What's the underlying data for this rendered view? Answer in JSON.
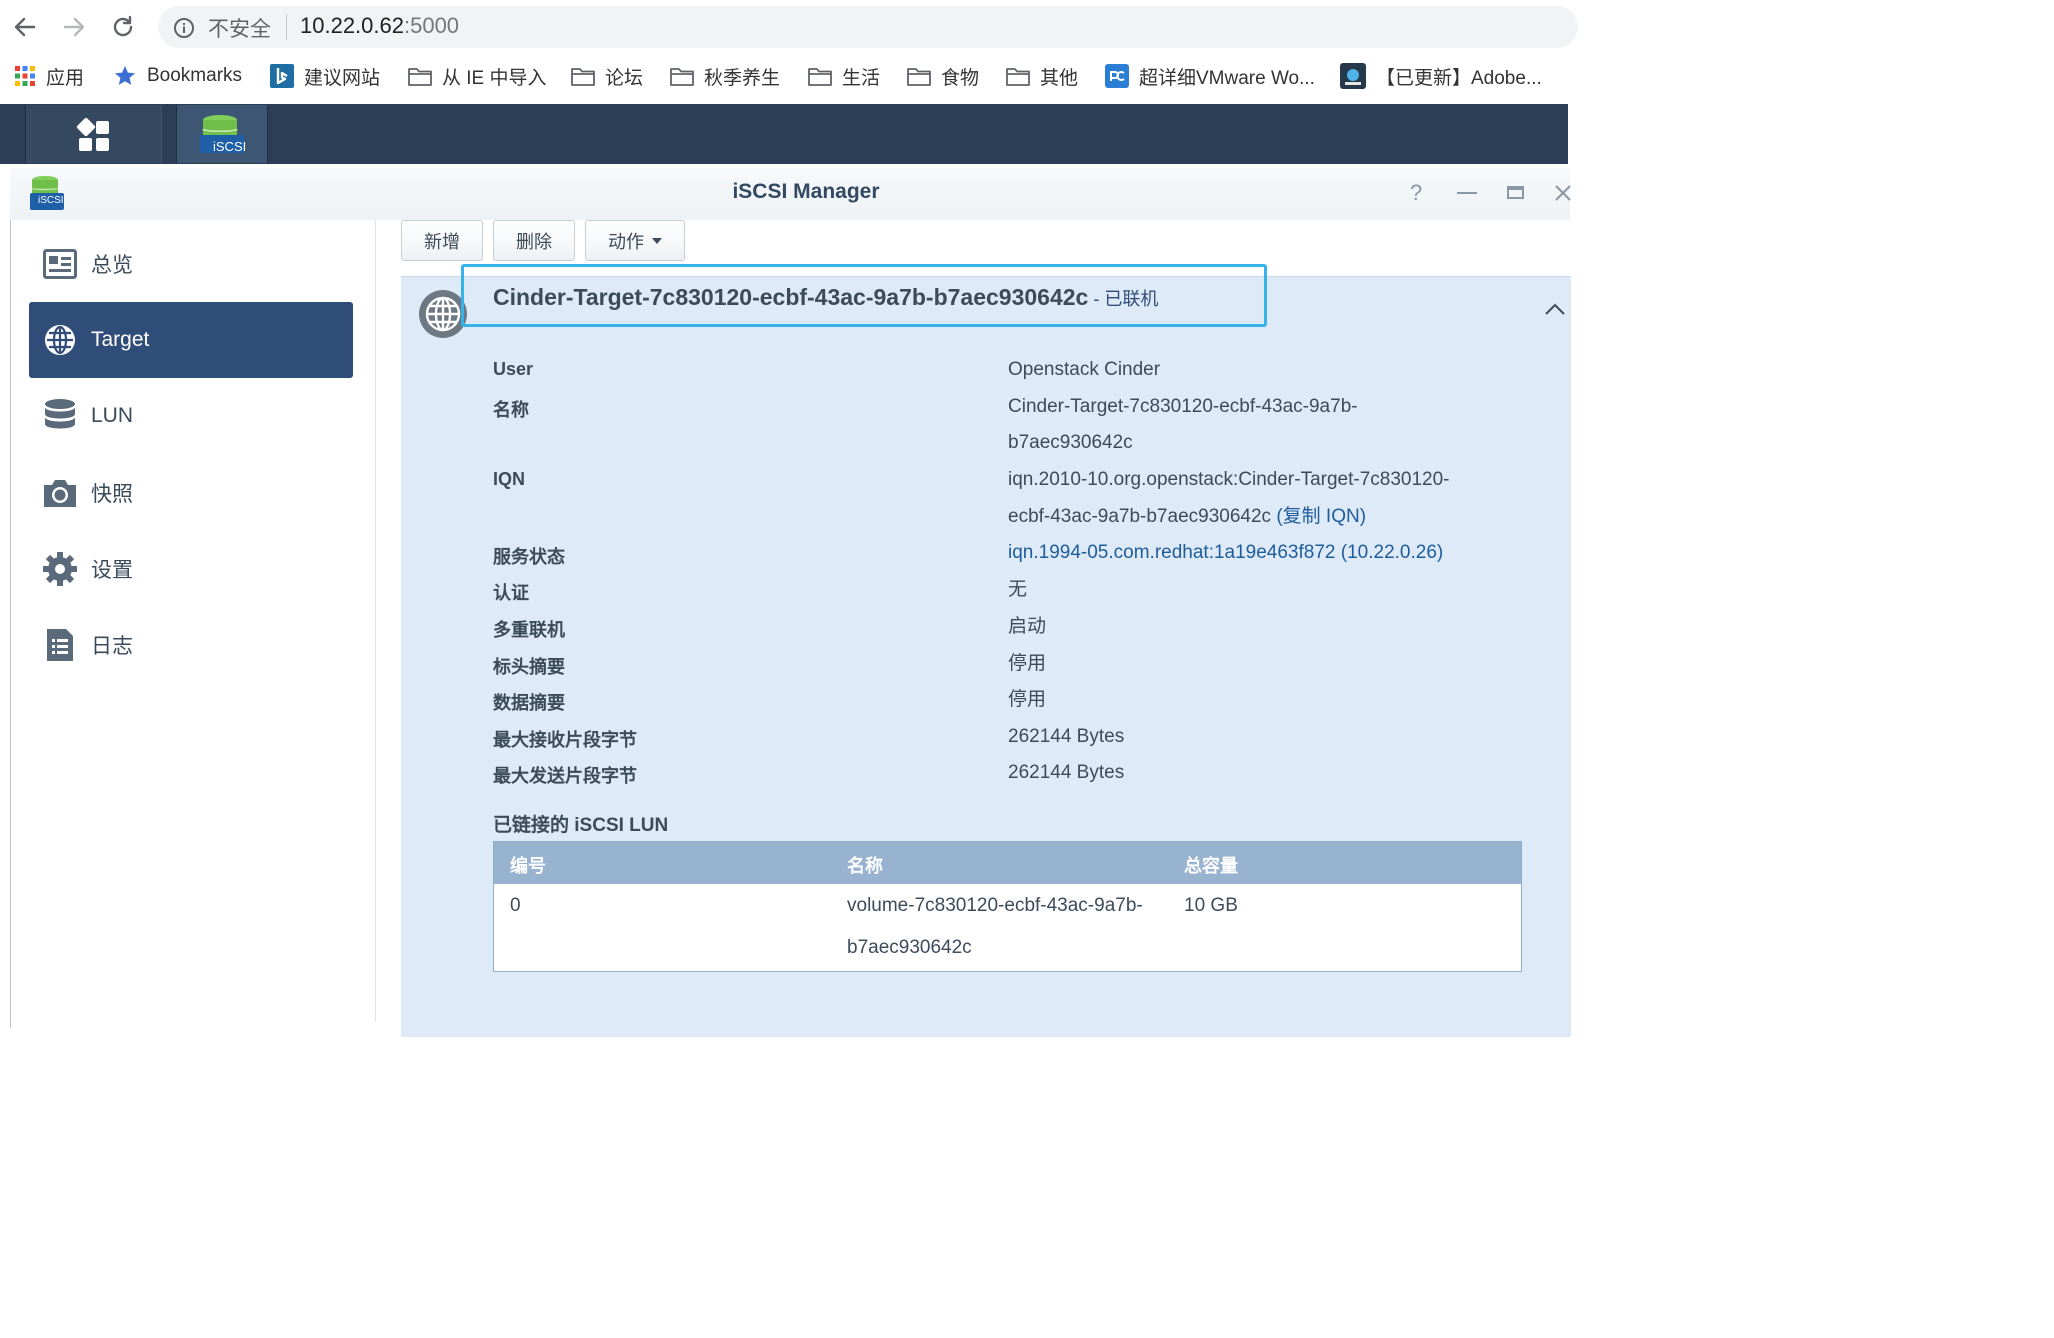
{
  "browser": {
    "security_label": "不安全",
    "url_host": "10.22.0.62",
    "url_port": ":5000",
    "bookmarks": [
      {
        "label": "应用",
        "icon": "apps-grid-icon"
      },
      {
        "label": "Bookmarks",
        "icon": "star-icon"
      },
      {
        "label": "建议网站",
        "icon": "bing-icon"
      },
      {
        "label": "从 IE 中导入",
        "icon": "folder-icon"
      },
      {
        "label": "论坛",
        "icon": "folder-icon"
      },
      {
        "label": "秋季养生",
        "icon": "folder-icon"
      },
      {
        "label": "生活",
        "icon": "folder-icon"
      },
      {
        "label": "食物",
        "icon": "folder-icon"
      },
      {
        "label": "其他",
        "icon": "folder-icon"
      },
      {
        "label": "超详细VMware Wo...",
        "icon": "pc-icon"
      },
      {
        "label": "【已更新】Adobe...",
        "icon": "site-icon"
      }
    ]
  },
  "taskbar": {
    "iscsi_badge": "iSCSI"
  },
  "window": {
    "title": "iSCSI Manager",
    "app_badge": "iSCSI",
    "help_glyph": "?"
  },
  "sidebar": {
    "items": [
      {
        "label": "总览",
        "icon": "overview-icon"
      },
      {
        "label": "Target",
        "icon": "globe-icon"
      },
      {
        "label": "LUN",
        "icon": "database-icon"
      },
      {
        "label": "快照",
        "icon": "camera-icon"
      },
      {
        "label": "设置",
        "icon": "gear-icon"
      },
      {
        "label": "日志",
        "icon": "log-list-icon"
      }
    ],
    "active_index": 1
  },
  "toolbar": {
    "add_label": "新增",
    "delete_label": "删除",
    "action_label": "动作"
  },
  "target": {
    "name": "Cinder-Target-7c830120-ecbf-43ac-9a7b-b7aec930642c",
    "status": " - 已联机",
    "details": [
      {
        "label": "User",
        "lines": [
          "Openstack Cinder"
        ]
      },
      {
        "label": "名称",
        "lines": [
          "Cinder-Target-7c830120-ecbf-43ac-9a7b-",
          "b7aec930642c"
        ]
      },
      {
        "label": "IQN",
        "lines": [
          "iqn.2010-10.org.openstack:Cinder-Target-7c830120-",
          "ecbf-43ac-9a7b-b7aec930642c"
        ],
        "link": "(复制 IQN)"
      },
      {
        "label": "服务状态",
        "lines": [
          "iqn.1994-05.com.redhat:1a19e463f872 (10.22.0.26)"
        ]
      },
      {
        "label": "认证",
        "lines": [
          "无"
        ]
      },
      {
        "label": "多重联机",
        "lines": [
          "启动"
        ]
      },
      {
        "label": "标头摘要",
        "lines": [
          "停用"
        ]
      },
      {
        "label": "数据摘要",
        "lines": [
          "停用"
        ]
      },
      {
        "label": "最大接收片段字节",
        "lines": [
          "262144 Bytes"
        ]
      },
      {
        "label": "最大发送片段字节",
        "lines": [
          "262144 Bytes"
        ]
      }
    ]
  },
  "lun_section": {
    "title": "已链接的 iSCSI LUN",
    "columns": [
      "编号",
      "名称",
      "总容量"
    ],
    "rows": [
      {
        "id": "0",
        "name_lines": [
          "volume-7c830120-ecbf-43ac-9a7b-",
          "b7aec930642c"
        ],
        "capacity": "10 GB"
      }
    ]
  }
}
